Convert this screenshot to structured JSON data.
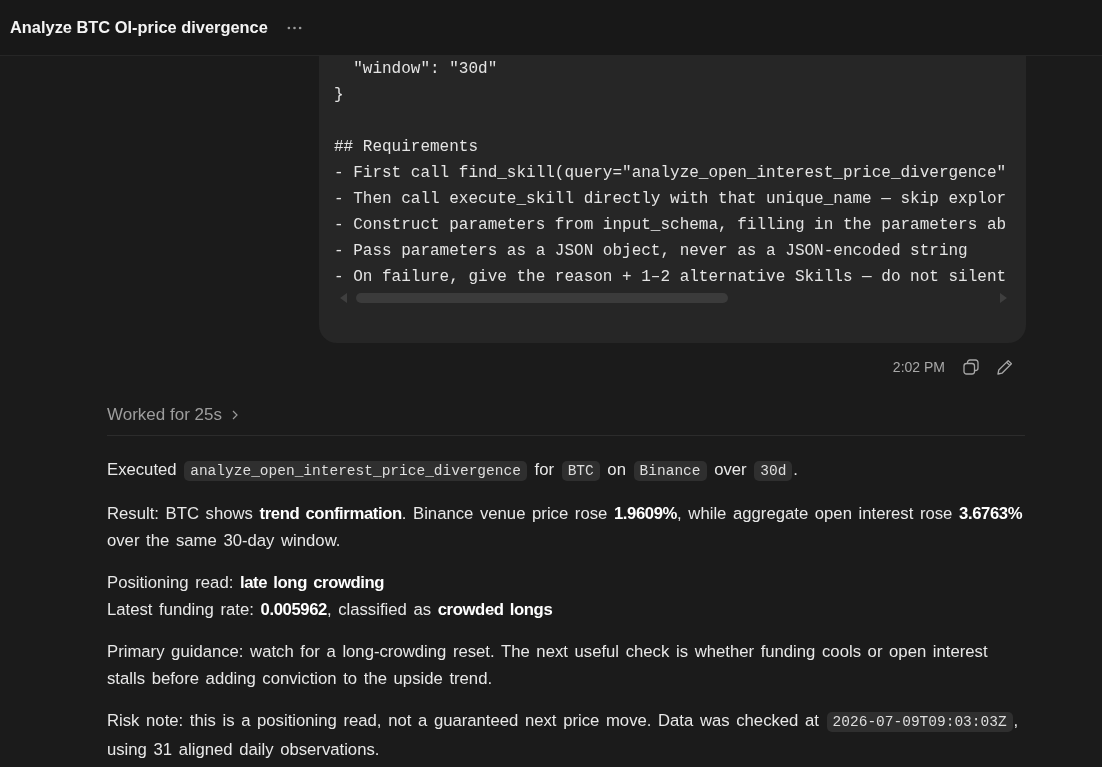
{
  "header": {
    "title": "Analyze BTC OI-price divergence"
  },
  "user_message": {
    "code_groups": [
      [
        "  \"window\": \"30d\"",
        "}"
      ],
      [
        "## Requirements",
        "- First call find_skill(query=\"analyze_open_interest_price_divergence\"",
        "- Then call execute_skill directly with that unique_name — skip explor",
        "- Construct parameters from input_schema, filling in the parameters ab",
        "- Pass parameters as a JSON object, never as a JSON-encoded string",
        "- On failure, give the reason + 1–2 alternative Skills — do not silent"
      ]
    ],
    "time": "2:02 PM"
  },
  "work_summary": {
    "label": "Worked for 25s",
    "expanded": false
  },
  "response": {
    "paragraphs": [
      {
        "lines": [
          [
            {
              "kind": "text",
              "text": "Executed "
            },
            {
              "kind": "code",
              "text": "analyze_open_interest_price_divergence"
            },
            {
              "kind": "text",
              "text": " for "
            },
            {
              "kind": "code",
              "text": "BTC"
            },
            {
              "kind": "text",
              "text": " on "
            },
            {
              "kind": "code",
              "text": "Binance"
            },
            {
              "kind": "text",
              "text": " over "
            },
            {
              "kind": "code",
              "text": "30d"
            },
            {
              "kind": "text",
              "text": "."
            }
          ]
        ]
      },
      {
        "lines": [
          [
            {
              "kind": "text",
              "text": "Result: BTC shows **trend confirmation**. Binance venue price rose **1.9609%**, while aggregate open interest rose **3.6763%** over the same 30-day window."
            }
          ]
        ]
      },
      {
        "lines": [
          [
            {
              "kind": "text",
              "text": "Positioning read: **late long crowding**"
            }
          ],
          [
            {
              "kind": "text",
              "text": "Latest funding rate: **0.005962**, classified as **crowded longs**"
            }
          ]
        ]
      },
      {
        "lines": [
          [
            {
              "kind": "text",
              "text": "Primary guidance: watch for a long-crowding reset. The next useful check is whether funding cools or open interest stalls before adding conviction to the upside trend."
            }
          ]
        ]
      },
      {
        "lines": [
          [
            {
              "kind": "text",
              "text": "Risk note: this is a positioning read, not a guaranteed next price move. Data was checked at "
            },
            {
              "kind": "code",
              "text": "2026-07-09T09:03:03Z"
            },
            {
              "kind": "text",
              "text": ", using 31 aligned daily observations."
            }
          ]
        ]
      }
    ]
  }
}
